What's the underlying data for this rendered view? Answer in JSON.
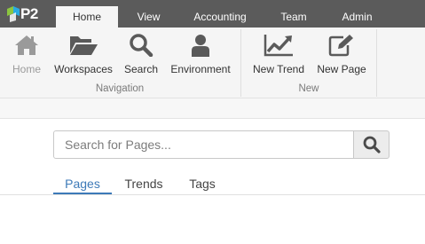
{
  "app": {
    "logo_text": "P2"
  },
  "top_tabs": [
    {
      "label": "Home",
      "active": true
    },
    {
      "label": "View",
      "active": false
    },
    {
      "label": "Accounting",
      "active": false
    },
    {
      "label": "Team",
      "active": false
    },
    {
      "label": "Admin",
      "active": false
    }
  ],
  "ribbon": {
    "groups": [
      {
        "label": "Navigation",
        "buttons": [
          {
            "label": "Home",
            "icon": "home-icon",
            "enabled": false
          },
          {
            "label": "Workspaces",
            "icon": "folder-open-icon",
            "enabled": true
          },
          {
            "label": "Search",
            "icon": "search-icon",
            "enabled": true
          },
          {
            "label": "Environment",
            "icon": "user-icon",
            "enabled": true
          }
        ]
      },
      {
        "label": "New",
        "buttons": [
          {
            "label": "New Trend",
            "icon": "line-chart-icon",
            "enabled": true
          },
          {
            "label": "New Page",
            "icon": "edit-icon",
            "enabled": true
          }
        ]
      }
    ]
  },
  "search": {
    "placeholder": "Search for Pages...",
    "value": "",
    "button_icon": "search-icon"
  },
  "content_tabs": [
    {
      "label": "Pages",
      "active": true
    },
    {
      "label": "Trends",
      "active": false
    },
    {
      "label": "Tags",
      "active": false
    }
  ],
  "colors": {
    "topbar": "#5b5b5b",
    "ribbon": "#f5f5f5",
    "accent": "#3d7ab8",
    "icon": "#5a5a5a",
    "icon_disabled": "#9a9a9a",
    "logo_green": "#8cc63f",
    "logo_blue": "#29abe2"
  }
}
